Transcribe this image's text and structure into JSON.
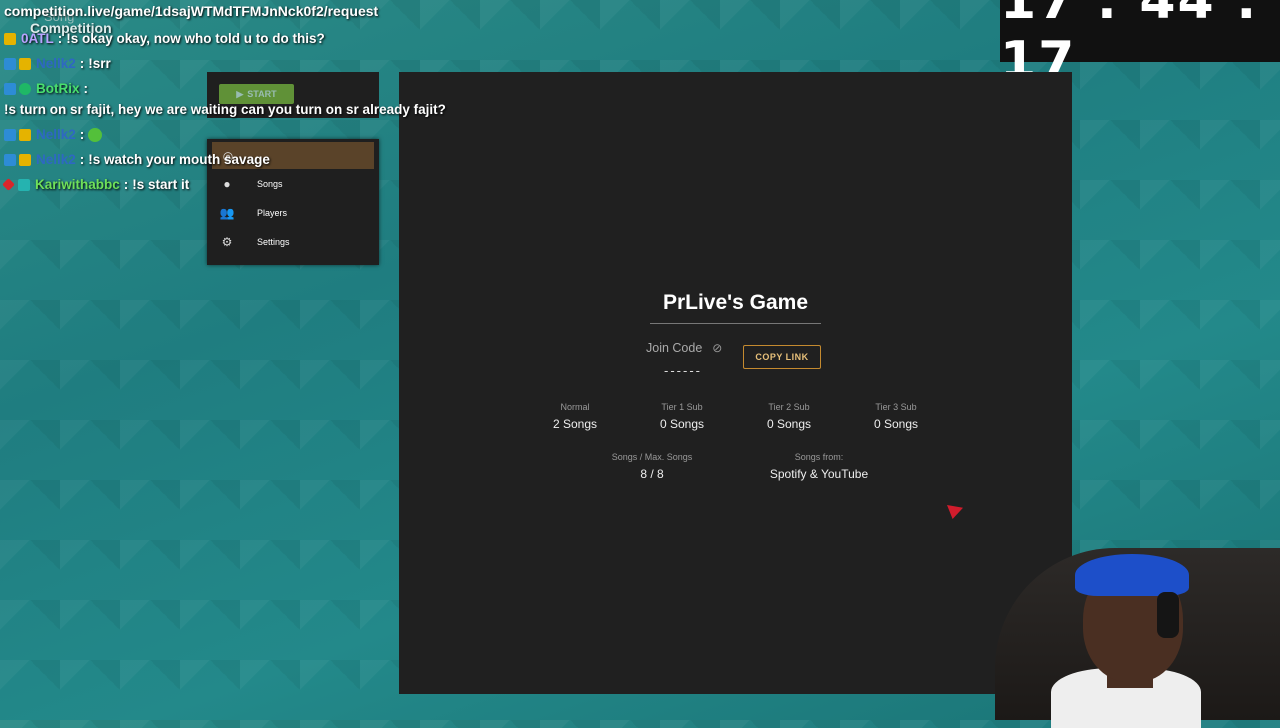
{
  "browser": {
    "url": "competition.live/game/1dsajWTMdTFMJnNck0f2/request",
    "ghost_title": "Competition",
    "ghost_sub": "Song"
  },
  "clock": {
    "time": "17 : 44 : 17"
  },
  "chat": {
    "messages": [
      {
        "user": "0ATL",
        "text": "!s okay okay, now who told u to do this?",
        "badges": [
          "crown"
        ],
        "color": "purple"
      },
      {
        "user": "Nellk2",
        "text": "!srr",
        "badges": [
          "blue",
          "crown"
        ],
        "color": "blue"
      },
      {
        "user": "BotRix",
        "text": "!s turn on sr fajit, hey we are waiting can you turn on sr already fajit?",
        "badges": [
          "blue",
          "green"
        ],
        "color": "green"
      },
      {
        "user": "Nellk2",
        "text": "",
        "badges": [
          "blue",
          "crown"
        ],
        "color": "blue",
        "emote": true
      },
      {
        "user": "Nellk2",
        "text": "!s watch your mouth savage",
        "badges": [
          "blue",
          "crown"
        ],
        "color": "blue"
      },
      {
        "user": "Kariwithabbc",
        "text": "!s start it",
        "badges": [
          "red",
          "teal"
        ],
        "color": "lime"
      }
    ]
  },
  "side_panel": {
    "start_label": "START",
    "items": [
      {
        "label": "",
        "icon": "play-circle-icon",
        "active": true
      },
      {
        "label": "Songs",
        "icon": "disc-icon"
      },
      {
        "label": "Players",
        "icon": "users-icon"
      },
      {
        "label": "Settings",
        "icon": "gear-icon"
      }
    ]
  },
  "game": {
    "title": "PrLive's Game",
    "join_code_label": "Join Code",
    "join_code": "------",
    "copy_link_label": "COPY LINK",
    "tiers": [
      {
        "label": "Normal",
        "value": "2 Songs"
      },
      {
        "label": "Tier 1 Sub",
        "value": "0 Songs"
      },
      {
        "label": "Tier 2 Sub",
        "value": "0 Songs"
      },
      {
        "label": "Tier 3 Sub",
        "value": "0 Songs"
      }
    ],
    "max_songs_label": "Songs / Max. Songs",
    "max_songs_value": "8 / 8",
    "sources_label": "Songs from:",
    "sources_value": "Spotify & YouTube"
  }
}
